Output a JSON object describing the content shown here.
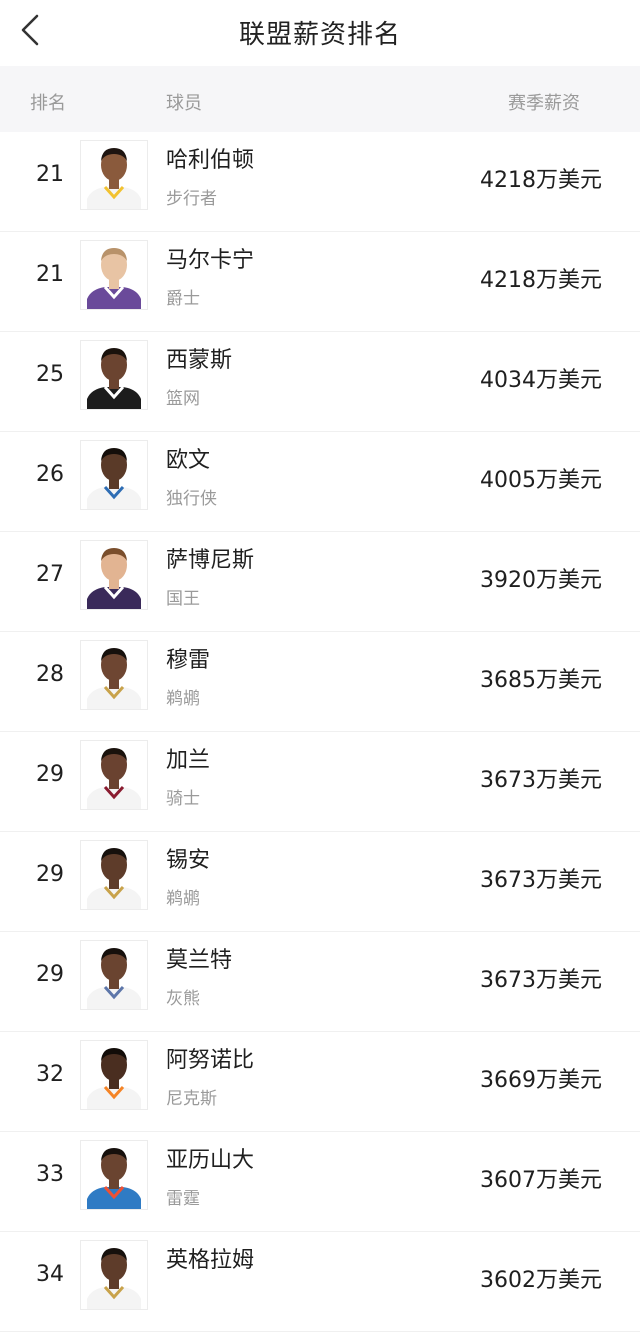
{
  "header": {
    "title": "联盟薪资排名"
  },
  "columns": {
    "rank": "排名",
    "player": "球员",
    "salary": "赛季薪资"
  },
  "colors": {
    "header_bg": "#ffffff",
    "column_header_bg": "#f6f6f8",
    "muted_text": "#9a9a9a",
    "primary_text": "#1f1f1f"
  },
  "players": [
    {
      "rank": "21",
      "name": "哈利伯顿",
      "team": "步行者",
      "salary": "4218万美元",
      "skin": "#8a5a3c",
      "hair": "#1e1410",
      "jersey": "#f4f4f4",
      "trim": "#f2c230"
    },
    {
      "rank": "21",
      "name": "马尔卡宁",
      "team": "爵士",
      "salary": "4218万美元",
      "skin": "#e8c4a4",
      "hair": "#b8926a",
      "jersey": "#6a4a9a",
      "trim": "#ffffff"
    },
    {
      "rank": "25",
      "name": "西蒙斯",
      "team": "篮网",
      "salary": "4034万美元",
      "skin": "#6b4430",
      "hair": "#1a120c",
      "jersey": "#1c1c1c",
      "trim": "#ffffff"
    },
    {
      "rank": "26",
      "name": "欧文",
      "team": "独行侠",
      "salary": "4005万美元",
      "skin": "#5a3a28",
      "hair": "#140e0a",
      "jersey": "#f4f4f4",
      "trim": "#2e6db4"
    },
    {
      "rank": "27",
      "name": "萨博尼斯",
      "team": "国王",
      "salary": "3920万美元",
      "skin": "#e2b492",
      "hair": "#7a4e2c",
      "jersey": "#3a2a5a",
      "trim": "#ffffff"
    },
    {
      "rank": "28",
      "name": "穆雷",
      "team": "鹈鹕",
      "salary": "3685万美元",
      "skin": "#6e4632",
      "hair": "#16100c",
      "jersey": "#f4f4f4",
      "trim": "#c8a24a"
    },
    {
      "rank": "29",
      "name": "加兰",
      "team": "骑士",
      "salary": "3673万美元",
      "skin": "#6a4230",
      "hair": "#1a120c",
      "jersey": "#f4f4f4",
      "trim": "#8a1c30"
    },
    {
      "rank": "29",
      "name": "锡安",
      "team": "鹈鹕",
      "salary": "3673万美元",
      "skin": "#5e3c2a",
      "hair": "#16100c",
      "jersey": "#f4f4f4",
      "trim": "#c8a24a"
    },
    {
      "rank": "29",
      "name": "莫兰特",
      "team": "灰熊",
      "salary": "3673万美元",
      "skin": "#6a4430",
      "hair": "#16100c",
      "jersey": "#f4f4f4",
      "trim": "#5d76a9"
    },
    {
      "rank": "32",
      "name": "阿努诺比",
      "team": "尼克斯",
      "salary": "3669万美元",
      "skin": "#4a2e20",
      "hair": "#120c08",
      "jersey": "#f4f4f4",
      "trim": "#f58426"
    },
    {
      "rank": "33",
      "name": "亚历山大",
      "team": "雷霆",
      "salary": "3607万美元",
      "skin": "#6a4430",
      "hair": "#16100c",
      "jersey": "#2f7bc4",
      "trim": "#f05133"
    },
    {
      "rank": "34",
      "name": "英格拉姆",
      "team": "",
      "salary": "3602万美元",
      "skin": "#5e3c2a",
      "hair": "#16100c",
      "jersey": "#f4f4f4",
      "trim": "#c8a24a"
    }
  ]
}
